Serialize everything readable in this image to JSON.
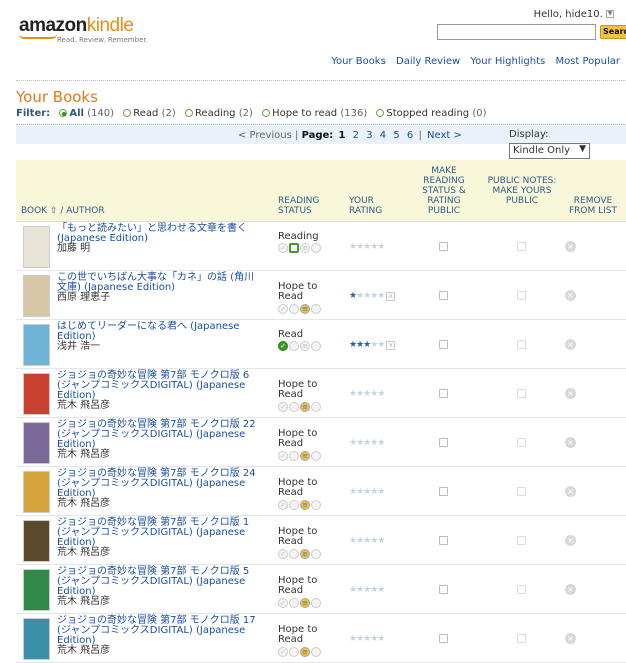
{
  "header": {
    "logo_brand_a": "amazon",
    "logo_brand_b": "kindle",
    "logo_tagline": "Read. Review. Remember.",
    "greeting": "Hello, hide10.",
    "search_placeholder": "",
    "search_button": "Search",
    "nav": [
      "Your Books",
      "Daily Review",
      "Your Highlights",
      "Most Popular"
    ]
  },
  "page_title": "Your Books",
  "filter": {
    "label": "Filter:",
    "options": [
      {
        "label": "All",
        "count": "(140)",
        "selected": true
      },
      {
        "label": "Read",
        "count": "(2)",
        "selected": false
      },
      {
        "label": "Reading",
        "count": "(2)",
        "selected": false
      },
      {
        "label": "Hope to read",
        "count": "(136)",
        "selected": false
      },
      {
        "label": "Stopped reading",
        "count": "(0)",
        "selected": false
      }
    ]
  },
  "pager": {
    "prev": "< Previous |",
    "page_label": "Page:",
    "current": "1",
    "pages": [
      "2",
      "3",
      "4",
      "5",
      "6"
    ],
    "sep": "|",
    "next": "Next >"
  },
  "display": {
    "label": "Display:",
    "value": "Kindle Only"
  },
  "columns": {
    "book": "BOOK ⇧ / AUTHOR",
    "status": "READING STATUS",
    "rating": "YOUR RATING",
    "public": "MAKE READING STATUS & RATING PUBLIC",
    "notes": "PUBLIC NOTES: MAKE YOURS PUBLIC",
    "remove": "REMOVE FROM LIST"
  },
  "books": [
    {
      "title": "「もっと読みたい」と思わせる文章を書く (Japanese Edition)",
      "author": "加藤 明",
      "status": "Reading",
      "state": "reading",
      "rating": 0,
      "cover": "#e8e4d8"
    },
    {
      "title": "この世でいちばん大事な「カネ」の話 (角川文庫) (Japanese Edition)",
      "author": "西原 理恵子",
      "status": "Hope to Read",
      "state": "hope",
      "rating": 1,
      "cover": "#d7c6a5"
    },
    {
      "title": "はじめてリーダーになる君へ (Japanese Edition)",
      "author": "浅井 浩一",
      "status": "Read",
      "state": "read",
      "rating": 3,
      "cover": "#6fb3d6"
    },
    {
      "title": "ジョジョの奇妙な冒険 第7部 モノクロ版 6 (ジャンプコミックスDIGITAL) (Japanese Edition)",
      "author": "荒木 飛呂彦",
      "status": "Hope to Read",
      "state": "hope",
      "rating": 0,
      "cover": "#c9412e"
    },
    {
      "title": "ジョジョの奇妙な冒険 第7部 モノクロ版 22 (ジャンプコミックスDIGITAL) (Japanese Edition)",
      "author": "荒木 飛呂彦",
      "status": "Hope to Read",
      "state": "hope",
      "rating": 0,
      "cover": "#7a6a9a"
    },
    {
      "title": "ジョジョの奇妙な冒険 第7部 モノクロ版 24 (ジャンプコミックスDIGITAL) (Japanese Edition)",
      "author": "荒木 飛呂彦",
      "status": "Hope to Read",
      "state": "hope",
      "rating": 0,
      "cover": "#d6a33c"
    },
    {
      "title": "ジョジョの奇妙な冒険 第7部 モノクロ版 1 (ジャンプコミックスDIGITAL) (Japanese Edition)",
      "author": "荒木 飛呂彦",
      "status": "Hope to Read",
      "state": "hope",
      "rating": 0,
      "cover": "#5d4a2e"
    },
    {
      "title": "ジョジョの奇妙な冒険 第7部 モノクロ版 5 (ジャンプコミックスDIGITAL) (Japanese Edition)",
      "author": "荒木 飛呂彦",
      "status": "Hope to Read",
      "state": "hope",
      "rating": 0,
      "cover": "#2f8a4a"
    },
    {
      "title": "ジョジョの奇妙な冒険 第7部 モノクロ版 17 (ジャンプコミックスDIGITAL) (Japanese Edition)",
      "author": "荒木 飛呂彦",
      "status": "Hope to Read",
      "state": "hope",
      "rating": 0,
      "cover": "#3c8fa8"
    }
  ],
  "icons": {
    "search": "search-icon",
    "dropdown": "chevron-down-icon",
    "remove": "remove-icon"
  },
  "colors": {
    "accent": "#e07a1a",
    "link": "#1a4ea3",
    "header_bg": "#f8f7d9",
    "pager_bg": "#eaf1f9"
  }
}
